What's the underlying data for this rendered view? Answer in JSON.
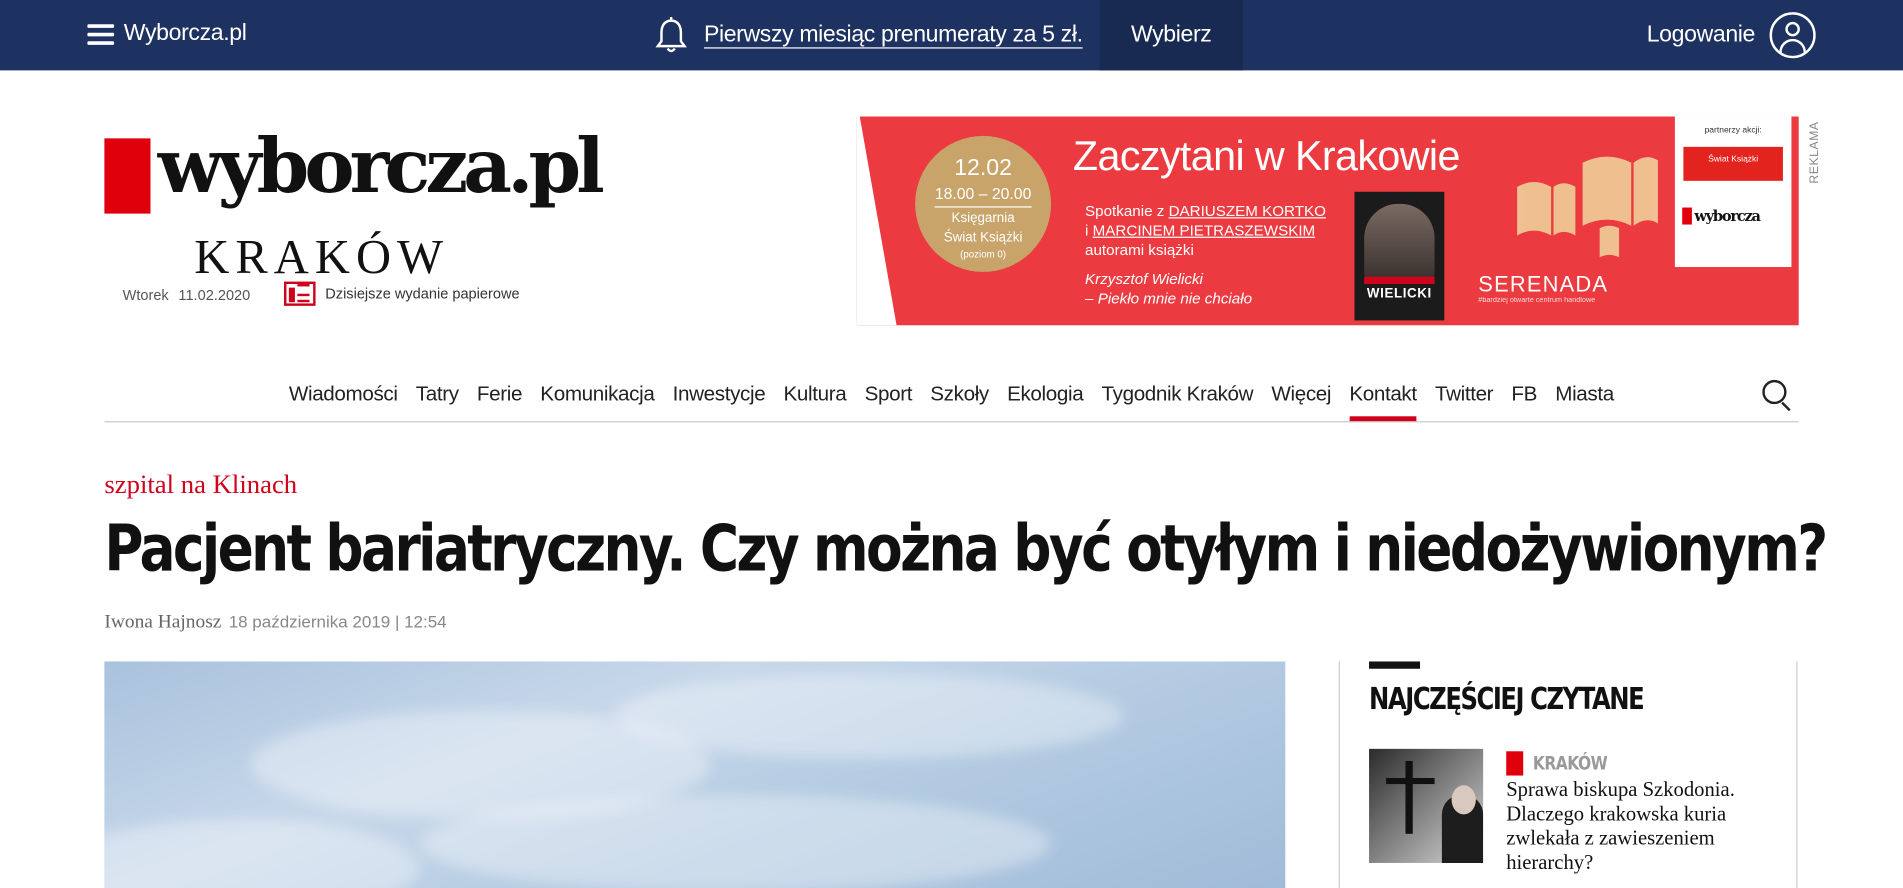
{
  "topbar": {
    "site_label": "Wyborcza.pl",
    "promo_text": "Pierwszy miesiąc prenumeraty za 5 zł.",
    "choose_label": "Wybierz",
    "login_label": "Logowanie",
    "colors": {
      "background": "#1e3261",
      "button": "#182a52"
    },
    "icons": [
      "hamburger-icon",
      "bell-icon",
      "user-icon"
    ]
  },
  "masthead": {
    "logo_text": "wyborcza.pl",
    "city": "KRAKÓW",
    "weekday": "Wtorek",
    "date": "11.02.2020",
    "paper_edition_link": "Dzisiejsze wydanie papierowe",
    "brand_red": "#e0000b"
  },
  "ad": {
    "tag": "REKLAMA",
    "headline": "Zaczytani w Krakowie",
    "date": "12.02",
    "time": "18.00 – 20.00",
    "place_line1": "Księgarnia",
    "place_line2": "Świat Książki",
    "place_note": "(poziom 0)",
    "copy_prefix": "Spotkanie z",
    "author1": "DARIUSZEM KORTKO",
    "copy_and": "i",
    "author2": "MARCINEM PIETRASZEWSKIM",
    "copy_suffix": "autorami książki",
    "book_line1": "Krzysztof Wielicki",
    "book_line2": "– Piekło mnie nie chciało",
    "book_cover_name": "WIELICKI",
    "mall_name": "SERENADA",
    "mall_sub": "#bardziej otwarte centrum handlowe",
    "partner_label": "partnerzy akcji:",
    "partner1": "Świat Książki",
    "partner2": "wyborcza",
    "background": "#ec3b40"
  },
  "nav": {
    "items": [
      "Wiadomości",
      "Tatry",
      "Ferie",
      "Komunikacja",
      "Inwestycje",
      "Kultura",
      "Sport",
      "Szkoły",
      "Ekologia",
      "Tygodnik Kraków",
      "Więcej",
      "Kontakt",
      "Twitter",
      "FB",
      "Miasta"
    ],
    "active": "Kontakt",
    "search_icon": "search-icon"
  },
  "article": {
    "kicker": "szpital na Klinach",
    "headline": "Pacjent bariatryczny. Czy można być otyłym i niedożywionym?",
    "author": "Iwona Hajnosz",
    "published": "18 października 2019 | 12:54"
  },
  "sidebar": {
    "heading": "NAJCZĘŚCIEJ CZYTANE",
    "items": [
      {
        "section": "KRAKÓW",
        "title": "Sprawa biskupa Szkodonia. Dlaczego krakowska kuria zwlekała z zawieszeniem hierarchy?"
      }
    ]
  }
}
